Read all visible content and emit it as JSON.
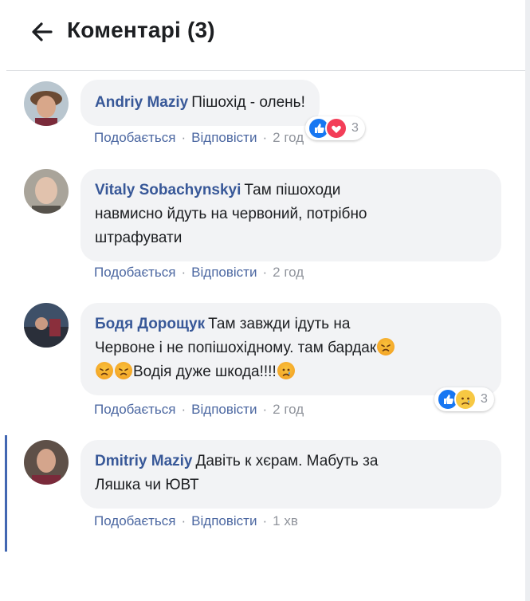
{
  "header": {
    "title": "Коментарі (3)"
  },
  "comments": [
    {
      "author": "Andriy Maziy",
      "text": "Пішохід - олень!",
      "like_label": "Подобається",
      "reply_label": "Відповісти",
      "time": "2 год",
      "reactions": {
        "types": [
          "like-icon",
          "love-icon"
        ],
        "count": "3"
      }
    },
    {
      "author": "Vitaly Sobachynskyi",
      "text": "Там пішоходи навмисно йдуть на червоний, потрібно штрафувати",
      "line1": "Там пішоходи",
      "line2": "навмисно йдуть на червоний, потрібно",
      "line3": "штрафувати",
      "like_label": "Подобається",
      "reply_label": "Відповісти",
      "time": "2 год"
    },
    {
      "author": "Бодя Дорощук",
      "line1": "Там завжди ідуть на",
      "line2": "Червоне і не попішохідному. там бардак",
      "line3": "Водія дуже шкода!!!!",
      "like_label": "Подобається",
      "reply_label": "Відповісти",
      "time": "2 год",
      "reactions": {
        "types": [
          "like-icon",
          "sad-icon"
        ],
        "count": "3"
      }
    },
    {
      "author": "Dmitriy Maziy",
      "line1": "Давіть к хєрам. Мабуть за",
      "line2": "Ляшка чи ЮВТ",
      "like_label": "Подобається",
      "reply_label": "Відповісти",
      "time": "1 хв"
    }
  ],
  "colors": {
    "link": "#385898",
    "meta": "#90949c",
    "bubble": "#f2f3f5",
    "accent": "#4267b2"
  }
}
